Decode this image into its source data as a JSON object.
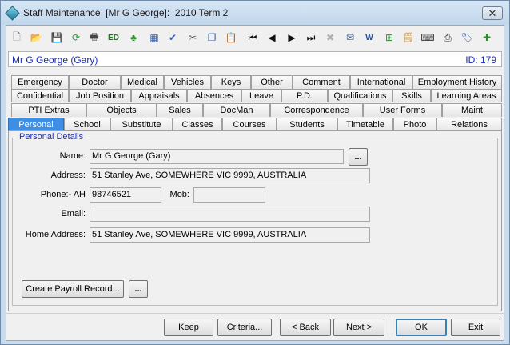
{
  "window": {
    "title": "Staff Maintenance  [Mr G George]:  2010 Term 2",
    "close_glyph": "✕"
  },
  "toolbar": {
    "icons": [
      {
        "name": "new-icon",
        "glyph": "🗋",
        "color": "#5a6a80"
      },
      {
        "name": "open-folder-icon",
        "glyph": "📂",
        "color": "#d69a1c"
      },
      {
        "name": "save-icon",
        "glyph": "💾",
        "color": "#9a9a9a"
      },
      {
        "name": "refresh-icon",
        "glyph": "⟳",
        "color": "#1f9a2e"
      },
      {
        "name": "print-icon",
        "glyph": "🖶",
        "color": "#444"
      },
      {
        "name": "edit-icon",
        "glyph": "ED",
        "color": "#1a7a1a"
      },
      {
        "name": "tree-icon",
        "glyph": "♣",
        "color": "#2e8a2e"
      },
      {
        "name": "calculator-icon",
        "glyph": "▦",
        "color": "#3a5fa8"
      },
      {
        "name": "spellcheck-icon",
        "glyph": "✔",
        "color": "#2a5bd0"
      },
      {
        "name": "cut-icon",
        "glyph": "✂",
        "color": "#555"
      },
      {
        "name": "copy-icon",
        "glyph": "❐",
        "color": "#3a5fa8"
      },
      {
        "name": "paste-icon",
        "glyph": "📋",
        "color": "#a47a2a"
      },
      {
        "name": "first-record-icon",
        "glyph": "⏮",
        "color": "#111"
      },
      {
        "name": "previous-record-icon",
        "glyph": "◀",
        "color": "#111"
      },
      {
        "name": "next-record-icon",
        "glyph": "▶",
        "color": "#111"
      },
      {
        "name": "last-record-icon",
        "glyph": "⏭",
        "color": "#111"
      },
      {
        "name": "delete-icon",
        "glyph": "✖",
        "color": "#b0b0b0"
      },
      {
        "name": "email-icon",
        "glyph": "✉",
        "color": "#3a5fa8"
      },
      {
        "name": "word-icon",
        "glyph": "W",
        "color": "#1f4fa8"
      },
      {
        "name": "excel-grid-icon",
        "glyph": "⊞",
        "color": "#2e8a2e"
      },
      {
        "name": "notes-icon",
        "glyph": "🗒",
        "color": "#c08a2a"
      },
      {
        "name": "keyboard-icon",
        "glyph": "⌨",
        "color": "#333"
      },
      {
        "name": "printer-setup-icon",
        "glyph": "⎙",
        "color": "#333"
      },
      {
        "name": "tag-icon",
        "glyph": "🏷",
        "color": "#3a5fa8"
      },
      {
        "name": "add-item-icon",
        "glyph": "✚",
        "color": "#2e8a2e"
      }
    ]
  },
  "header": {
    "staff_name": "Mr G George (Gary)",
    "staff_id": "ID: 179"
  },
  "tabs": {
    "row1": [
      "Emergency",
      "Doctor",
      "Medical",
      "Vehicles",
      "Keys",
      "Other",
      "Comment",
      "International",
      "Employment History"
    ],
    "row2": [
      "Confidential",
      "Job Position",
      "Appraisals",
      "Absences",
      "Leave",
      "P.D.",
      "Qualifications",
      "Skills",
      "Learning Areas"
    ],
    "row3": [
      "PTI Extras",
      "Objects",
      "Sales",
      "DocMan",
      "Correspondence",
      "User Forms",
      "Maint"
    ],
    "row4": [
      "Personal",
      "School",
      "Substitute",
      "Classes",
      "Courses",
      "Students",
      "Timetable",
      "Photo",
      "Relations"
    ],
    "active": "Personal"
  },
  "personal": {
    "group_title": "Personal Details",
    "name_label": "Name:",
    "name_value": "Mr G George  (Gary)",
    "name_button": "...",
    "address_label": "Address:",
    "address_value": "51 Stanley Ave, SOMEWHERE VIC 9999, AUSTRALIA",
    "phone_label": "Phone:-  AH",
    "phone_ah_value": "98746521",
    "mob_label": "Mob:",
    "mob_value": "",
    "email_label": "Email:",
    "email_value": "",
    "home_address_label": "Home Address:",
    "home_address_value": "51 Stanley Ave, SOMEWHERE VIC 9999, AUSTRALIA",
    "create_payroll_label": "Create Payroll Record...",
    "payroll_more_label": "..."
  },
  "footer": {
    "keep": "Keep",
    "criteria": "Criteria...",
    "back": "< Back",
    "next": "Next >",
    "ok": "OK",
    "exit": "Exit"
  }
}
